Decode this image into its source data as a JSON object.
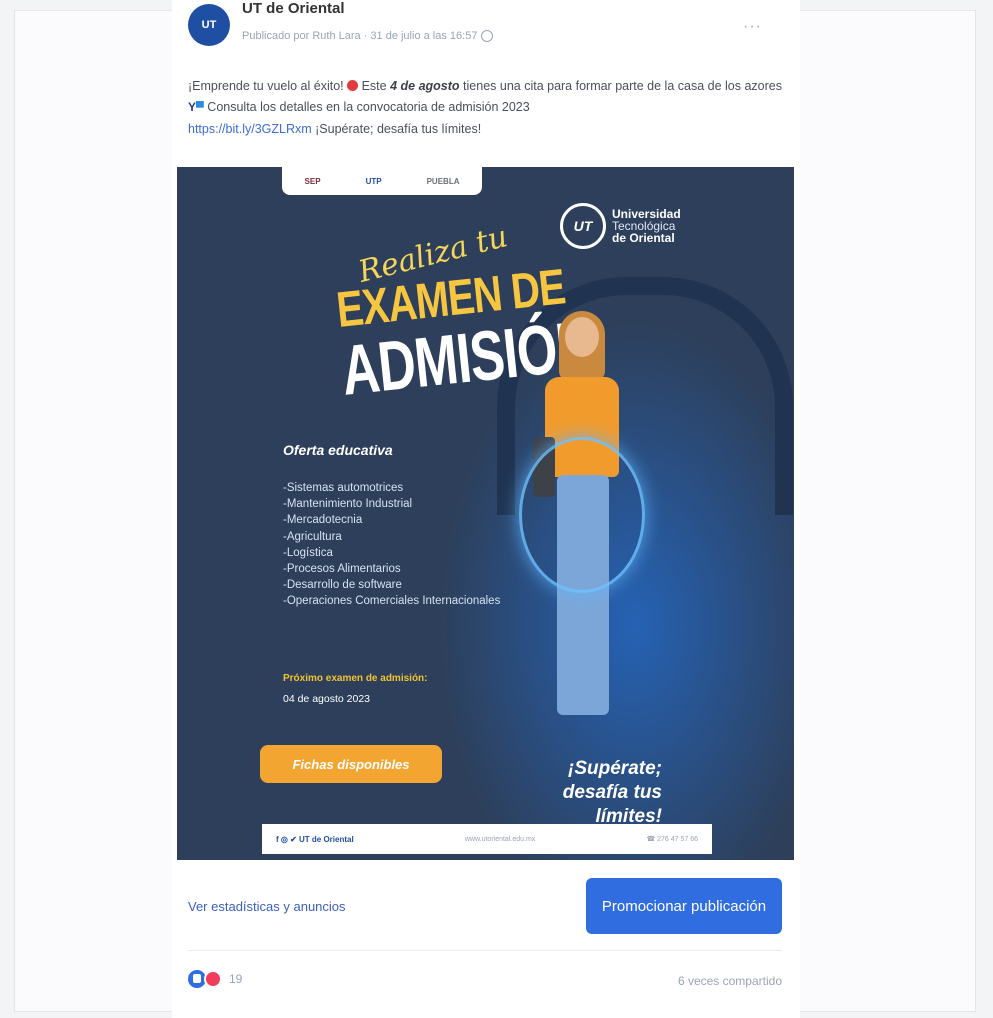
{
  "post": {
    "page_name": "UT de Oriental",
    "avatar_label": "UT",
    "meta": "Publicado por Ruth Lara · 31 de julio a las 16:57",
    "more_label": "···",
    "text": {
      "part1": "¡Emprende tu vuelo al éxito! ",
      "part2": " Este ",
      "bold": "4 de agosto",
      "part3": " tienes una cita para formar parte de la casa de los azores ",
      "part4": " Consulta los detalles en la convocatoria de admisión 2023",
      "link": "https://bit.ly/3GZLRxm",
      "part5": " ¡Supérate; desafía tus límites!"
    }
  },
  "poster": {
    "logo_strip": [
      "SEP",
      "UTP",
      "PUEBLA"
    ],
    "university": {
      "circle": "UT",
      "line1": "Universidad",
      "line2": "Tecnológica",
      "line3": "de Oriental"
    },
    "script_title": "Realiza tu",
    "title_line1": "EXAMEN DE",
    "title_line2": "ADMISIÓN",
    "offer_title": "Oferta educativa",
    "offer_items": [
      "-Sistemas automotrices",
      "-Mantenimiento Industrial",
      "-Mercadotecnia",
      "-Agricultura",
      "-Logística",
      "-Procesos Alimentarios",
      "-Desarrollo de software",
      "-Operaciones Comerciales Internacionales"
    ],
    "next_exam_label": "Próximo examen de admisión:",
    "next_exam_date": "04 de agosto 2023",
    "button_label": "Fichas disponibles",
    "slogan_line1": "¡Supérate;",
    "slogan_line2": "desafía tus límites!",
    "footer_social": "f ◎ ✔ UT de Oriental",
    "footer_web": "www.utoriental.edu.mx",
    "footer_phone": "☎ 276 47 57 66"
  },
  "actions": {
    "stats_link": "Ver estadísticas y anuncios",
    "promote_button": "Promocionar publicación"
  },
  "engagement": {
    "reaction_count": "19",
    "shares": "6 veces compartido"
  }
}
